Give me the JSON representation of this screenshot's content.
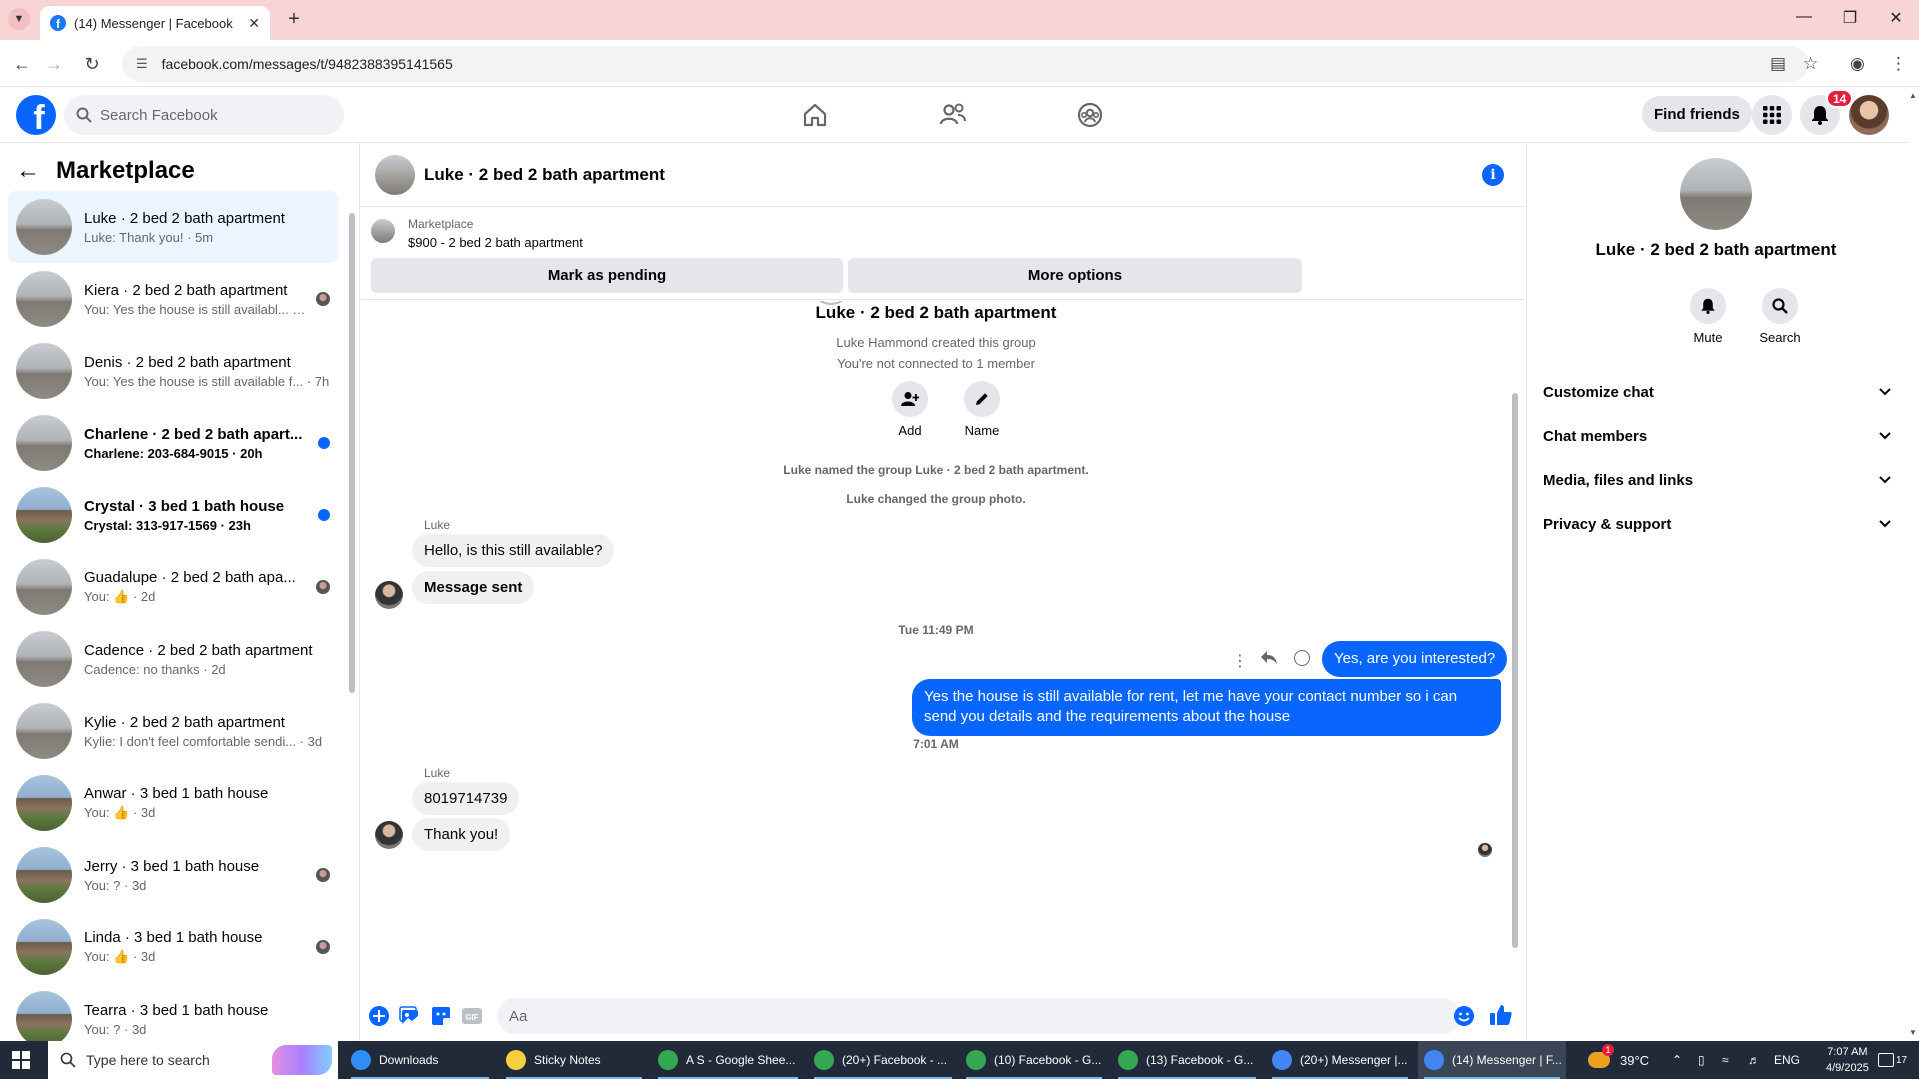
{
  "browser": {
    "tab_title": "(14) Messenger | Facebook",
    "url": "facebook.com/messages/t/9482388395141565"
  },
  "fb_header": {
    "search_placeholder": "Search Facebook",
    "find_friends": "Find friends",
    "notification_count": "14"
  },
  "sidebar": {
    "title": "Marketplace",
    "conversations": [
      {
        "name": "Luke · 2 bed 2 bath apartment",
        "preview": "Luke: Thank you! · 5m",
        "thumb": "apartment",
        "mark": "none",
        "unread": false
      },
      {
        "name": "Kiera · 2 bed 2 bath apartment",
        "preview": "You: Yes the house is still availabl... · 7h",
        "thumb": "apartment",
        "mark": "seen",
        "unread": false
      },
      {
        "name": "Denis · 2 bed 2 bath apartment",
        "preview": "You: Yes the house is still available f... · 7h",
        "thumb": "apartment",
        "mark": "none",
        "unread": false
      },
      {
        "name": "Charlene · 2 bed 2 bath apart...",
        "preview": "Charlene: 203-684-9015 · 20h",
        "thumb": "apartment",
        "mark": "dot",
        "unread": true
      },
      {
        "name": "Crystal · 3 bed 1 bath house",
        "preview": "Crystal: 313-917-1569 · 23h",
        "thumb": "house",
        "mark": "dot",
        "unread": true
      },
      {
        "name": "Guadalupe · 2 bed 2 bath apa...",
        "preview": "You: 👍 · 2d",
        "thumb": "apartment",
        "mark": "seen",
        "unread": false
      },
      {
        "name": "Cadence · 2 bed 2 bath apartment",
        "preview": "Cadence: no thanks · 2d",
        "thumb": "apartment",
        "mark": "none",
        "unread": false
      },
      {
        "name": "Kylie · 2 bed 2 bath apartment",
        "preview": "Kylie: I don't feel comfortable sendi... · 3d",
        "thumb": "apartment",
        "mark": "none",
        "unread": false
      },
      {
        "name": "Anwar · 3 bed 1 bath house",
        "preview": "You: 👍 · 3d",
        "thumb": "house",
        "mark": "none",
        "unread": false
      },
      {
        "name": "Jerry · 3 bed 1 bath house",
        "preview": "You: ? · 3d",
        "thumb": "house",
        "mark": "seen",
        "unread": false
      },
      {
        "name": "Linda · 3 bed 1 bath house",
        "preview": "You: 👍 · 3d",
        "thumb": "house",
        "mark": "seen",
        "unread": false
      },
      {
        "name": "Tearra · 3 bed 1 bath house",
        "preview": "You: ? · 3d",
        "thumb": "house",
        "mark": "none",
        "unread": false
      }
    ]
  },
  "chat": {
    "title": "Luke · 2 bed 2 bath apartment",
    "listing_category": "Marketplace",
    "listing_price_title": "$900 - 2 bed 2 bath apartment",
    "mark_pending": "Mark as pending",
    "more_options": "More options",
    "group_title": "Luke · 2 bed 2 bath apartment",
    "created_text": "Luke Hammond created this group",
    "connected_text": "You're not connected to 1 member",
    "add_label": "Add",
    "name_label": "Name",
    "event_named": "Luke named the group Luke · 2 bed 2 bath apartment.",
    "event_photo": "Luke changed the group photo.",
    "sender_1": "Luke",
    "msg_in_1": "Hello, is this still available?",
    "msg_in_2": "Message sent",
    "timestamp_1": "Tue 11:49 PM",
    "msg_out_1": "Yes, are you interested?",
    "msg_out_2": "Yes the house is still available for rent, let me have your contact number so i can send you details and the requirements about the house",
    "timestamp_2": "7:01 AM",
    "sender_2": "Luke",
    "msg_in_3": "8019714739",
    "msg_in_4": "Thank you!",
    "composer_placeholder": "Aa"
  },
  "info_panel": {
    "name": "Luke · 2 bed 2 bath apartment",
    "mute": "Mute",
    "search": "Search",
    "sections": [
      "Customize chat",
      "Chat members",
      "Media, files and links",
      "Privacy & support"
    ]
  },
  "taskbar": {
    "search_placeholder": "Type here to search",
    "items": [
      {
        "label": "Downloads",
        "icon_color": "#2f8ef5"
      },
      {
        "label": "Sticky Notes",
        "icon_color": "#f4d03f"
      },
      {
        "label": "A S - Google Shee...",
        "icon_color": "#34a853"
      },
      {
        "label": "(20+) Facebook - ...",
        "icon_color": "#34a853"
      },
      {
        "label": "(10) Facebook - G...",
        "icon_color": "#34a853"
      },
      {
        "label": "(13) Facebook - G...",
        "icon_color": "#34a853"
      },
      {
        "label": "(20+) Messenger |...",
        "icon_color": "#4285f4"
      },
      {
        "label": "(14) Messenger | F...",
        "icon_color": "#4285f4"
      }
    ],
    "weather": "39°C",
    "weather_badge": "1",
    "language": "ENG",
    "time": "7:07 AM",
    "date": "4/9/2025",
    "notif_count": "17"
  },
  "colors": {
    "fb_blue": "#0866ff",
    "tab_strip": "#f9d4d4",
    "badge_red": "#e41e3f",
    "taskbar": "#202a38"
  }
}
